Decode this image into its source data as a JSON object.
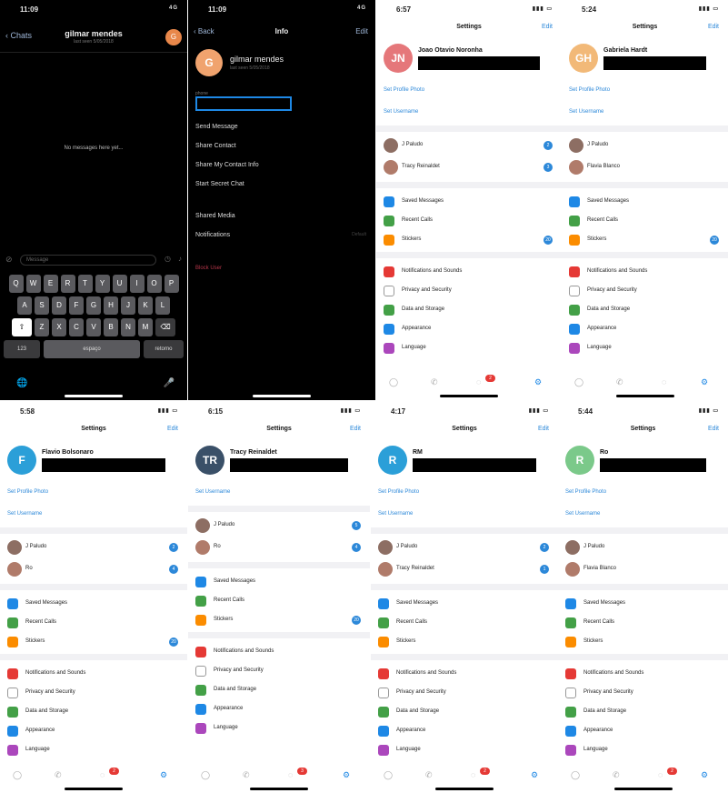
{
  "chat": {
    "time": "11:09",
    "signal": "4G",
    "back": "Chats",
    "name": "gilmar mendes",
    "subtitle": "last seen 5/05/2018",
    "avatar": "G",
    "empty": "No messages here yet...",
    "input_placeholder": "Message",
    "keys_row1": [
      "Q",
      "W",
      "E",
      "R",
      "T",
      "Y",
      "U",
      "I",
      "O",
      "P"
    ],
    "keys_row2": [
      "A",
      "S",
      "D",
      "F",
      "G",
      "H",
      "J",
      "K",
      "L"
    ],
    "keys_row3": [
      "Z",
      "X",
      "C",
      "V",
      "B",
      "N",
      "M"
    ],
    "key_numbers": "123",
    "key_space": "espaço",
    "key_return": "retorno",
    "globe_icon": "🌐",
    "mic_icon": "🎤"
  },
  "info": {
    "time": "11:09",
    "signal": "4G",
    "back": "Back",
    "title": "Info",
    "edit": "Edit",
    "avatar": "G",
    "name": "gilmar mendes",
    "subtitle": "last seen 5/05/2018",
    "field_label": "phone",
    "actions": [
      "Send Message",
      "Share Contact",
      "Share My Contact Info",
      "Start Secret Chat"
    ],
    "shared_media": "Shared Media",
    "notifications": "Notifications",
    "notifications_value": "Default",
    "block": "Block User"
  },
  "settings_common": {
    "title": "Settings",
    "edit": "Edit",
    "set_photo": "Set Profile Photo",
    "set_username": "Set Username",
    "saved": "Saved Messages",
    "calls": "Recent Calls",
    "stickers": "Stickers",
    "notif": "Notifications and Sounds",
    "privacy": "Privacy and Security",
    "data": "Data and Storage",
    "appearance": "Appearance",
    "language": "Language"
  },
  "panels": [
    {
      "time": "6:57",
      "name": "Joao Otavio Noronha",
      "avatar": "JN",
      "color": "#e5777a",
      "acc1": "J Paludo",
      "acc2": "Tracy Reinaldet",
      "badge1": "2",
      "badge2": "3",
      "stickers_badge": "20",
      "tab_badge": "2"
    },
    {
      "time": "5:24",
      "name": "Gabriela Hardt",
      "avatar": "GH",
      "color": "#f2b978",
      "acc1": "J Paludo",
      "acc2": "Flavia Blanco",
      "badge1": "",
      "badge2": "",
      "stickers_badge": "20",
      "tab_badge": ""
    },
    {
      "time": "5:58",
      "name": "Flavio Bolsonaro",
      "avatar": "F",
      "color": "#2b9fd8",
      "acc1": "J Paludo",
      "acc2": "Ro",
      "badge1": "2",
      "badge2": "4",
      "stickers_badge": "20",
      "tab_badge": "2"
    },
    {
      "time": "6:15",
      "name": "Tracy Reinaldet",
      "avatar": "TR",
      "color": "#3a5068",
      "acc1": "J Paludo",
      "acc2": "Ro",
      "badge1": "5",
      "badge2": "4",
      "stickers_badge": "20",
      "tab_badge": "3"
    },
    {
      "time": "4:17",
      "name": "RM",
      "avatar": "R",
      "color": "#2b9fd8",
      "acc1": "J Paludo",
      "acc2": "Tracy Reinaldet",
      "badge1": "2",
      "badge2": "1",
      "stickers_badge": "",
      "tab_badge": "2"
    },
    {
      "time": "5:44",
      "name": "Ro",
      "avatar": "R",
      "color": "#7bc98a",
      "acc1": "J Paludo",
      "acc2": "Flavia Blanco",
      "badge1": "",
      "badge2": "",
      "stickers_badge": "",
      "tab_badge": "2"
    }
  ],
  "colors": {
    "accent": "#2c88d9",
    "saved": "#1e88e5",
    "calls": "#43a047",
    "stickers": "#fb8c00",
    "notif": "#e53935",
    "privacy": "#9e9e9e",
    "data": "#43a047",
    "appearance": "#1e88e5",
    "language": "#ab47bc"
  }
}
